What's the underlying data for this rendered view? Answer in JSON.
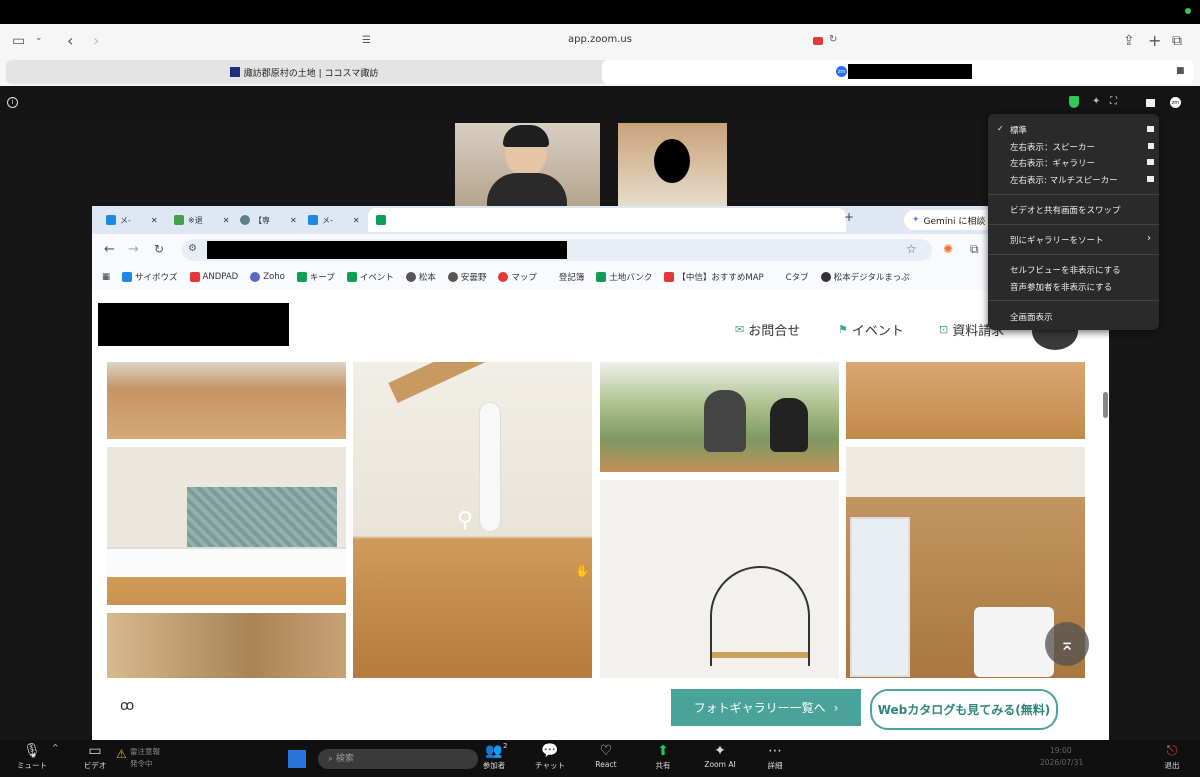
{
  "safari": {
    "url": "app.zoom.us",
    "tab1": "諏訪郡原村の土地 | ココスマ諏訪"
  },
  "zoom": {
    "info_icon": "info-icon",
    "shield_icon": "shield-icon"
  },
  "view_menu": {
    "items": [
      "標準",
      "左右表示：スピーカー",
      "左右表示：ギャラリー",
      "左右表示: マルチスピーカー",
      "ビデオと共有画面をスワップ",
      "別にギャラリーをソート",
      "セルフビューを非表示にする",
      "音声参加者を非表示にする",
      "全画面表示"
    ],
    "checked": "✓"
  },
  "chrome": {
    "tabs": [
      "メ-",
      "※退",
      "【専",
      "メ-"
    ],
    "gemini": "Gemini に相談",
    "new_tab": "+",
    "bookmarks": [
      "サイボウズ",
      "ANDPAD",
      "Zoho",
      "キープ",
      "イベント",
      "松本",
      "安曇野",
      "マップ",
      "登記簿",
      "土地バンク",
      "【中信】おすすめMAP",
      "Cタブ",
      "松本デジタルまっぷ"
    ]
  },
  "site": {
    "nav": [
      "お問合せ",
      "イベント",
      "資料請求"
    ],
    "gallery_button": "フォトギャラリー一覧へ",
    "catalog_button": "Webカタログも見てみる(無料)"
  },
  "taskbar": {
    "mute": "ミュート",
    "video": "ビデオ",
    "participants": "参加者",
    "participants_count": "2",
    "chat": "チャット",
    "react": "React",
    "share": "共有",
    "zoom_ai": "Zoom AI",
    "more": "詳細",
    "leave": "退出",
    "weather_title": "雷注意報",
    "weather_sub": "発令中",
    "search": "検索",
    "time": "19:00",
    "date": "2026/07/31"
  },
  "colors": {
    "accent": "#4aa39a",
    "zoom_blue": "#2d6cf5"
  }
}
